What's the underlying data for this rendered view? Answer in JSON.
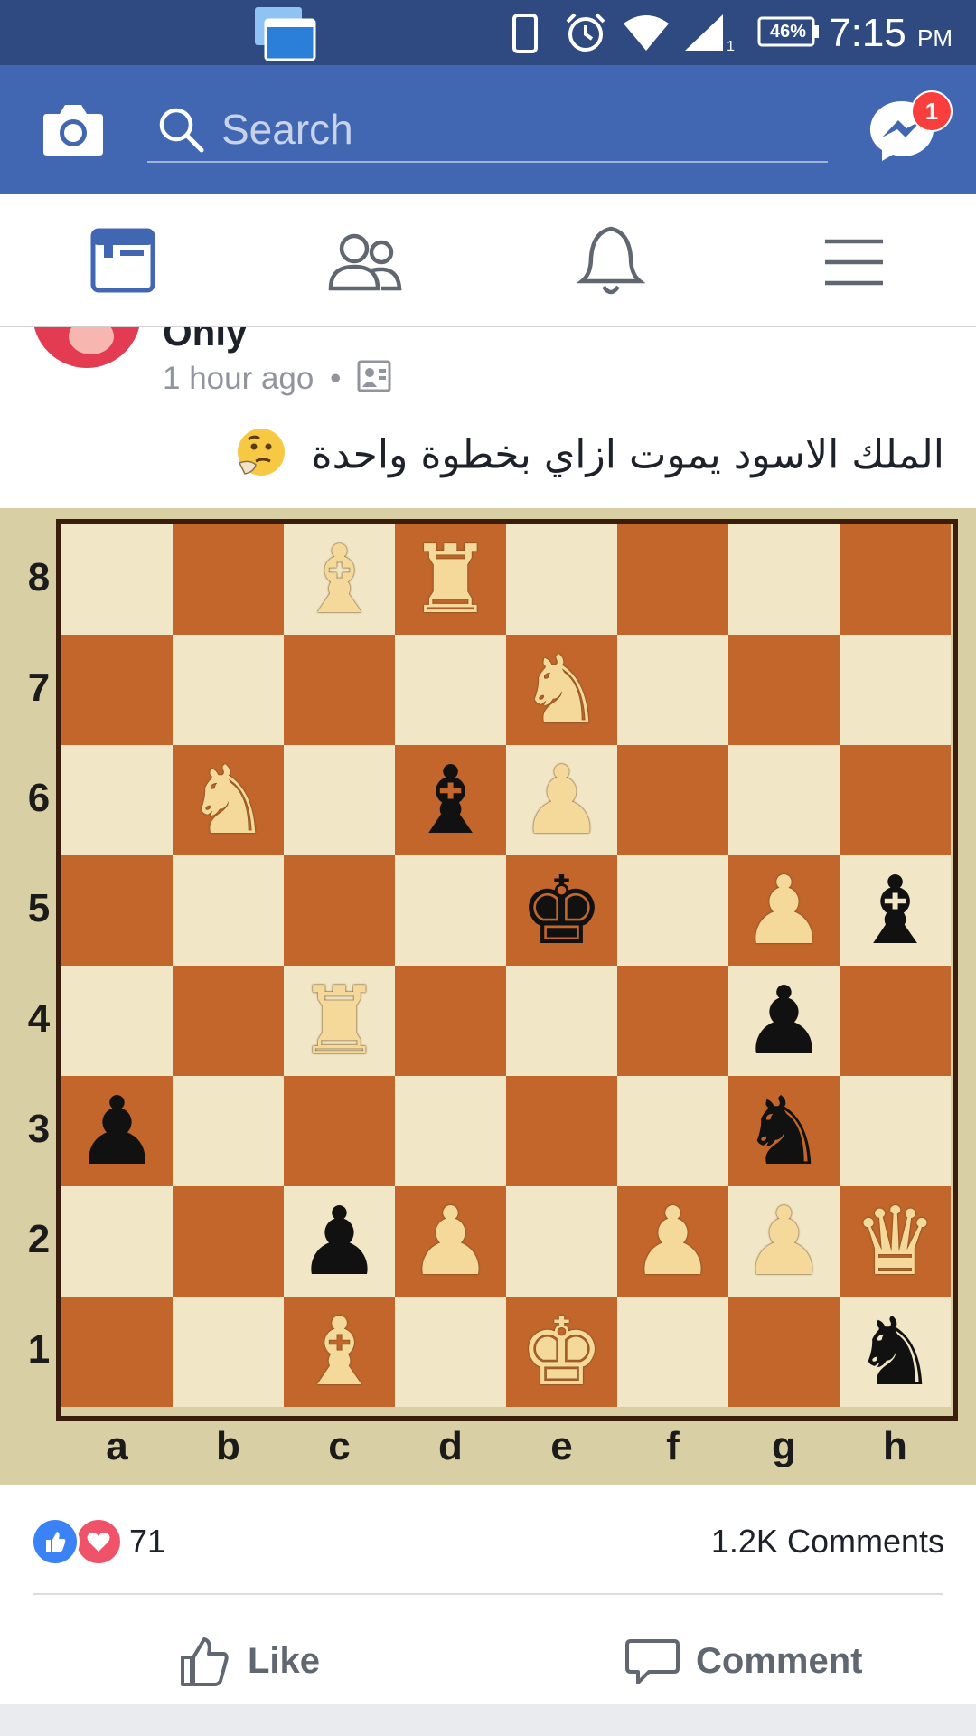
{
  "status_bar": {
    "battery": "46%",
    "time": "7:15",
    "ampm": "PM"
  },
  "header": {
    "search_placeholder": "Search",
    "messenger_badge": "1"
  },
  "nav": {
    "items": [
      "news-feed",
      "friends",
      "notifications",
      "menu"
    ]
  },
  "post": {
    "author": "Only",
    "time": "1 hour ago",
    "separator": "•",
    "caption": "الملك الاسود يموت ازاي بخطوة واحدة",
    "caption_emoji": "🤔",
    "likes": "71",
    "comments": "1.2K Comments",
    "like_label": "Like",
    "comment_label": "Comment"
  },
  "chess": {
    "ranks": [
      "8",
      "7",
      "6",
      "5",
      "4",
      "3",
      "2",
      "1"
    ],
    "files": [
      "a",
      "b",
      "c",
      "d",
      "e",
      "f",
      "g",
      "h"
    ],
    "pieces": [
      {
        "sq": "c8",
        "c": "w",
        "t": "B"
      },
      {
        "sq": "d8",
        "c": "w",
        "t": "R"
      },
      {
        "sq": "e7",
        "c": "w",
        "t": "N"
      },
      {
        "sq": "b6",
        "c": "w",
        "t": "N"
      },
      {
        "sq": "d6",
        "c": "b",
        "t": "B"
      },
      {
        "sq": "e6",
        "c": "w",
        "t": "P"
      },
      {
        "sq": "e5",
        "c": "b",
        "t": "K"
      },
      {
        "sq": "g5",
        "c": "w",
        "t": "P"
      },
      {
        "sq": "h5",
        "c": "b",
        "t": "B"
      },
      {
        "sq": "c4",
        "c": "w",
        "t": "R"
      },
      {
        "sq": "g4",
        "c": "b",
        "t": "P"
      },
      {
        "sq": "a3",
        "c": "b",
        "t": "P"
      },
      {
        "sq": "g3",
        "c": "b",
        "t": "N"
      },
      {
        "sq": "c2",
        "c": "b",
        "t": "P"
      },
      {
        "sq": "d2",
        "c": "w",
        "t": "P"
      },
      {
        "sq": "f2",
        "c": "w",
        "t": "P"
      },
      {
        "sq": "g2",
        "c": "w",
        "t": "P"
      },
      {
        "sq": "h2",
        "c": "w",
        "t": "Q"
      },
      {
        "sq": "c1",
        "c": "w",
        "t": "B"
      },
      {
        "sq": "e1",
        "c": "w",
        "t": "K"
      },
      {
        "sq": "h1",
        "c": "b",
        "t": "N"
      }
    ]
  },
  "colors": {
    "header_blue": "#4267b2",
    "status_blue": "#2f4a80",
    "light_square": "#f1e6c6",
    "dark_square": "#c2662b"
  }
}
